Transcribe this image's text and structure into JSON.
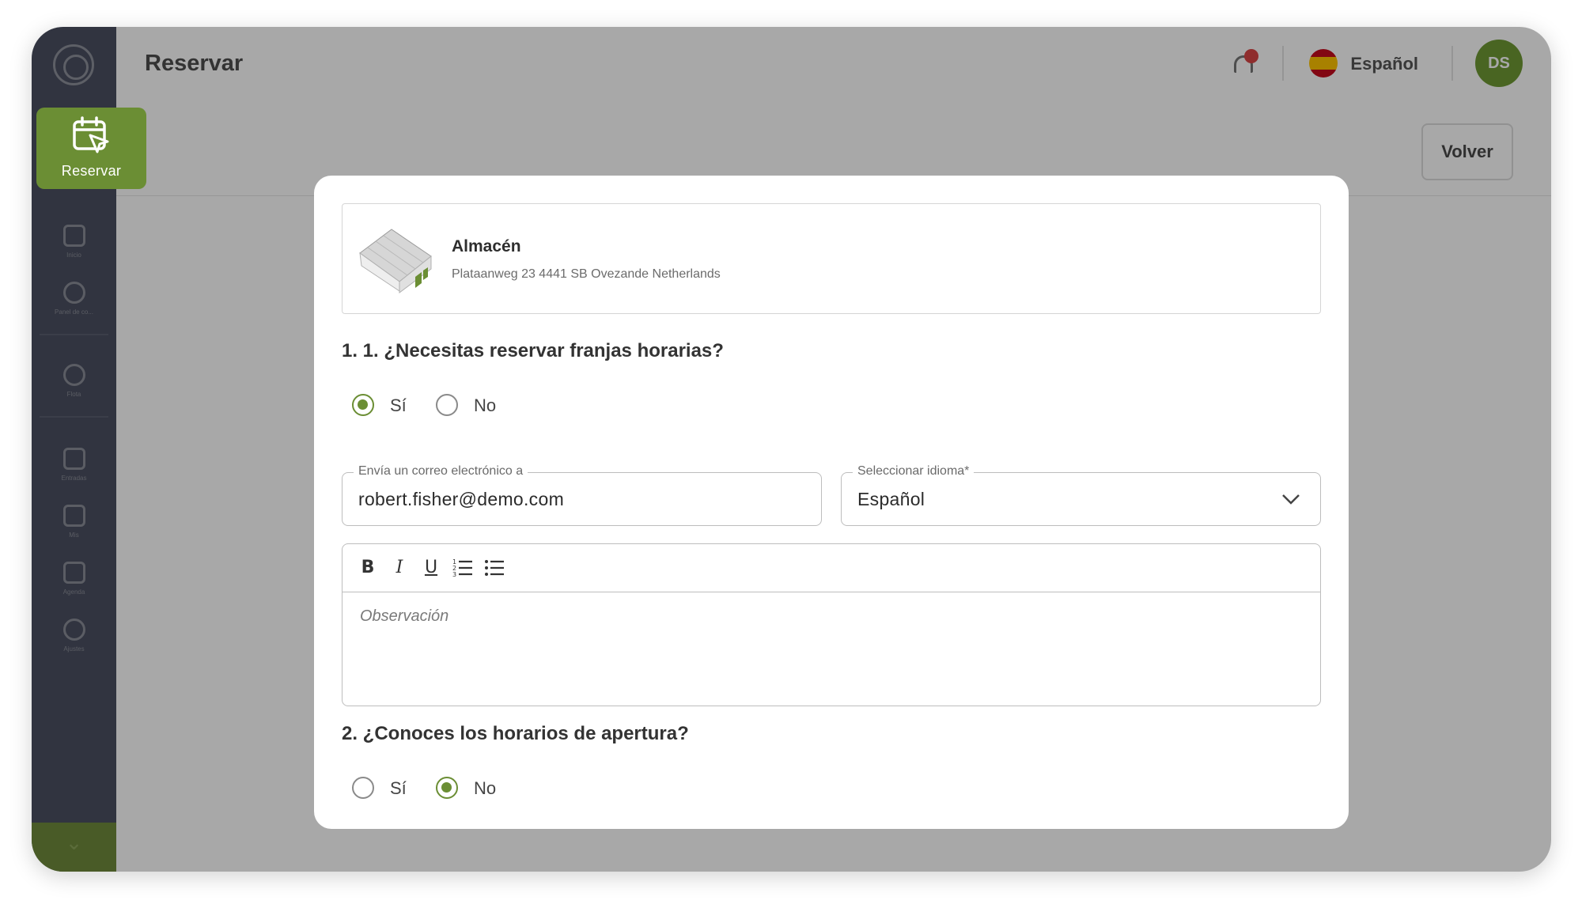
{
  "app": {
    "page_title": "Reservar",
    "active_nav_label": "Reservar",
    "language": "Español",
    "avatar_initials": "DS",
    "back_button": "Volver"
  },
  "sidebar": {
    "items": [
      {
        "label": "Inicio",
        "icon": "home-icon"
      },
      {
        "label": "Panel de co...",
        "icon": "chart-icon"
      },
      {
        "label": "Flota",
        "icon": "fleet-icon"
      },
      {
        "label": "Entradas",
        "icon": "document-icon"
      },
      {
        "label": "Mis",
        "icon": "file-icon"
      },
      {
        "label": "Agenda",
        "icon": "calendar-icon"
      },
      {
        "label": "Ajustes",
        "icon": "gear-icon"
      }
    ]
  },
  "modal": {
    "location": {
      "name": "Almacén",
      "address": "Plataanweg 23 4441 SB Ovezande Netherlands",
      "icon": "warehouse-icon"
    },
    "question1": {
      "title": "1. 1. ¿Necesitas reservar franjas horarias?",
      "options": [
        "Sí",
        "No"
      ],
      "selected": "Sí"
    },
    "email_field": {
      "label": "Envía un correo electrónico a",
      "value": "robert.fisher@demo.com"
    },
    "language_field": {
      "label": "Seleccionar idioma*",
      "value": "Español"
    },
    "editor": {
      "placeholder": "Observación",
      "tools": [
        "bold",
        "italic",
        "underline",
        "ordered-list",
        "bullet-list"
      ]
    },
    "question2": {
      "title": "2. ¿Conoces los horarios de apertura?",
      "options": [
        "Sí",
        "No"
      ],
      "selected": "No"
    }
  },
  "colors": {
    "accent": "#6b8e34",
    "sidebar": "#4b5061",
    "overlay": "rgba(0,0,0,0.34)"
  }
}
